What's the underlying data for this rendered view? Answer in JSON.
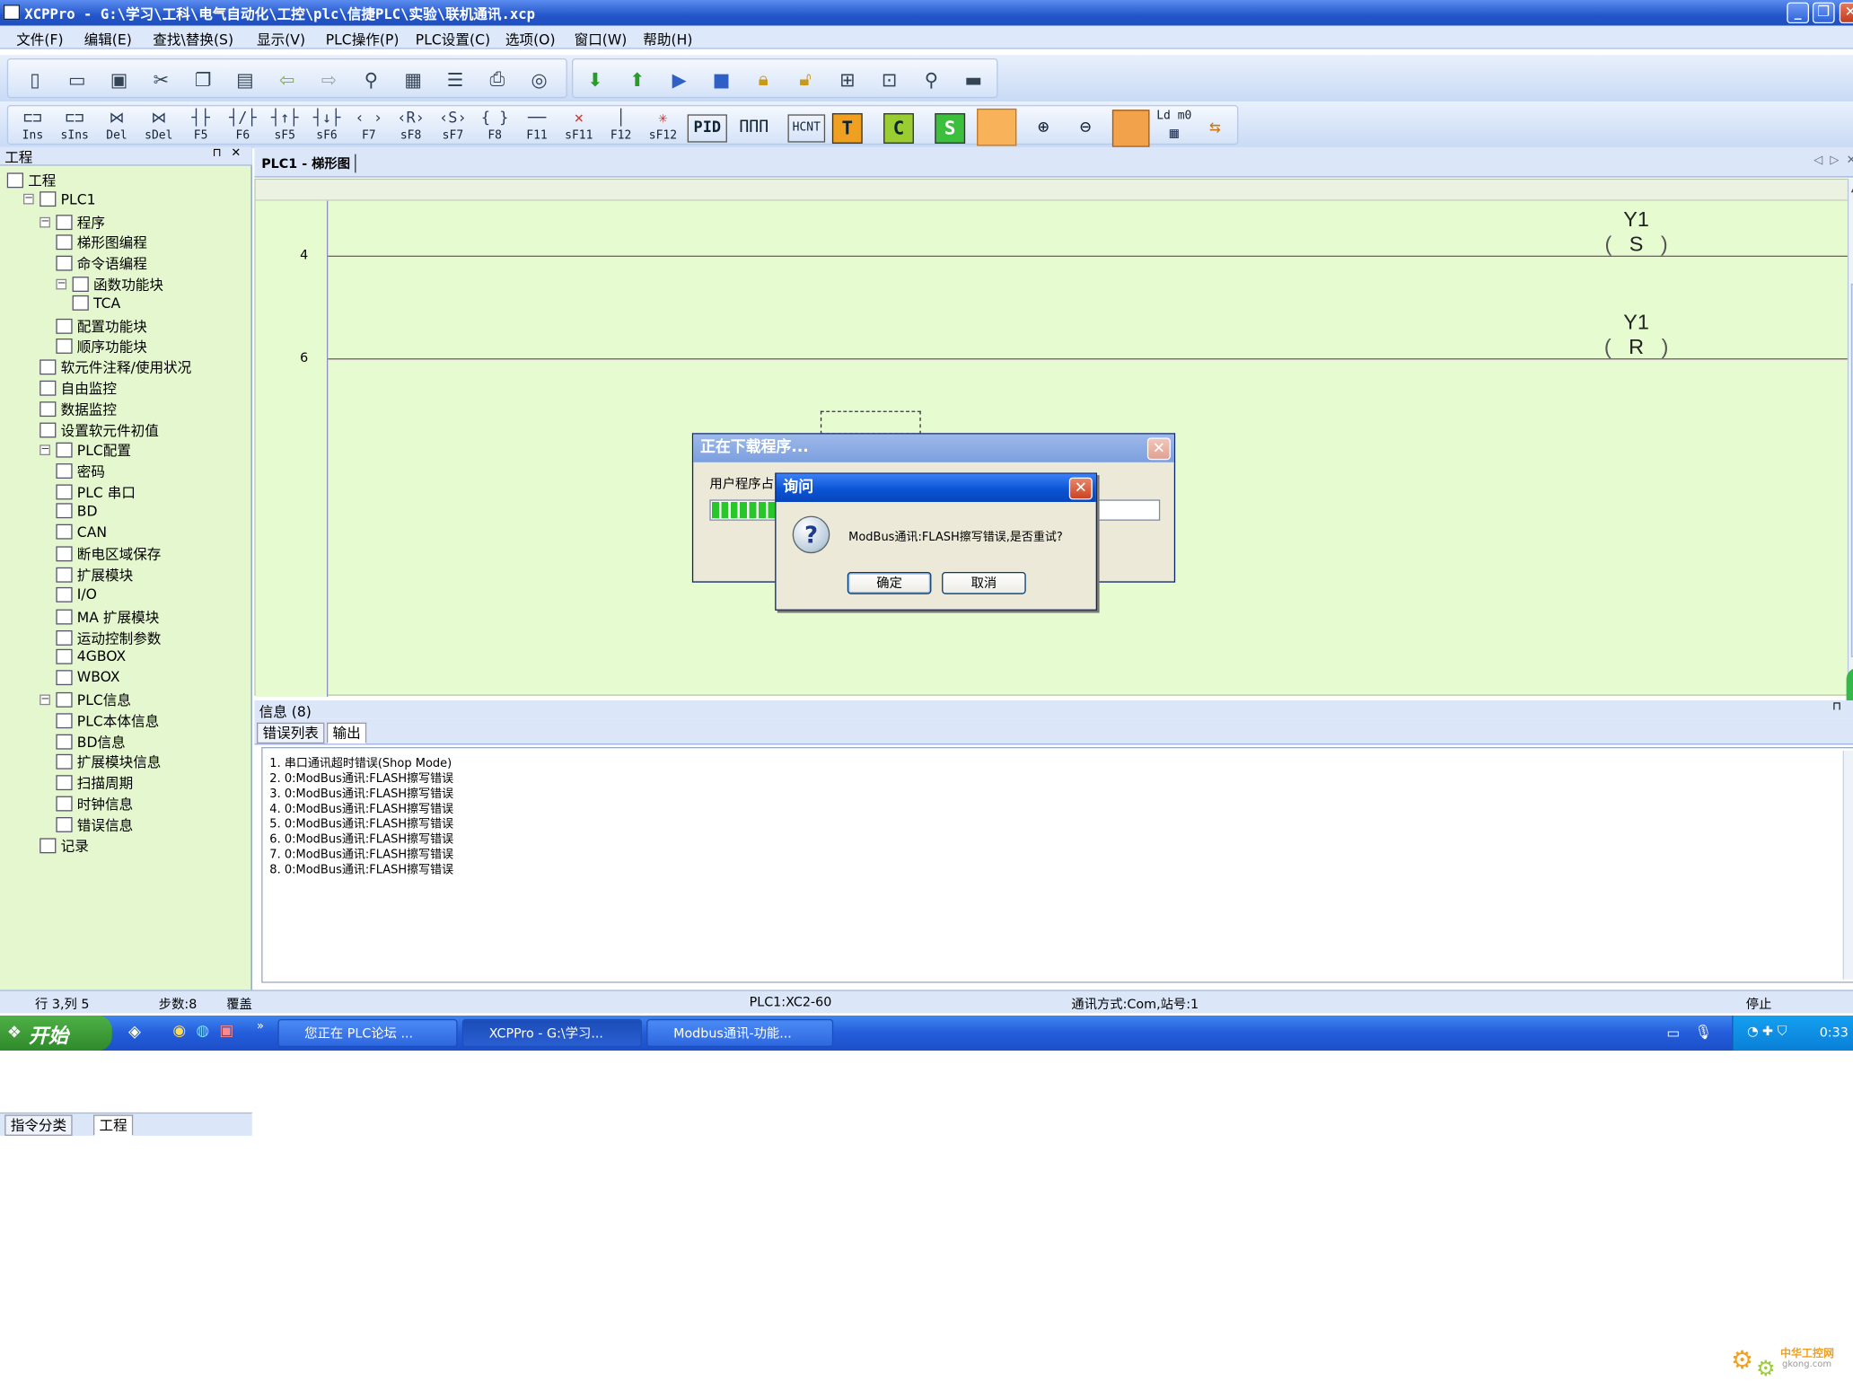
{
  "window": {
    "title": "XCPPro - G:\\学习\\工科\\电气自动化\\工控\\plc\\信捷PLC\\实验\\联机通讯.xcp",
    "minimize": "_",
    "restore": "❐",
    "close": "✕"
  },
  "menu": [
    "文件(F)",
    "编辑(E)",
    "查找\\替换(S)",
    "显示(V)",
    "PLC操作(P)",
    "PLC设置(C)",
    "选项(O)",
    "窗口(W)",
    "帮助(H)"
  ],
  "ladder_toolbar": {
    "labels": [
      "Ins",
      "sIns",
      "Del",
      "sDel",
      "F5",
      "F6",
      "sF5",
      "sF6",
      "F7",
      "sF8",
      "sF7",
      "F8",
      "F11",
      "sF11",
      "F12",
      "sF12"
    ],
    "extra": [
      "PID",
      "HCNT",
      "T",
      "C",
      "S",
      "Ld m0"
    ]
  },
  "sidebar": {
    "header": "工程",
    "pin": "⊓",
    "close": "✕",
    "tree": [
      {
        "label": "工程",
        "icon": "project-icon",
        "level": 0
      },
      {
        "label": "PLC1",
        "icon": "plc-icon",
        "level": 1
      },
      {
        "label": "程序",
        "icon": "program-icon",
        "level": 2
      },
      {
        "label": "梯形图编程",
        "icon": "ladder-icon",
        "level": 3
      },
      {
        "label": "命令语编程",
        "icon": "instruction-icon",
        "level": 3
      },
      {
        "label": "函数功能块",
        "icon": "function-block-icon",
        "level": 3
      },
      {
        "label": "TCA",
        "icon": "file-icon",
        "level": 4
      },
      {
        "label": "配置功能块",
        "icon": "config-block-icon",
        "level": 3
      },
      {
        "label": "顺序功能块",
        "icon": "sequence-block-icon",
        "level": 3
      },
      {
        "label": "软元件注释/使用状况",
        "icon": "device-comment-icon",
        "level": 2
      },
      {
        "label": "自由监控",
        "icon": "monitor-icon",
        "level": 2
      },
      {
        "label": "数据监控",
        "icon": "data-monitor-icon",
        "level": 2
      },
      {
        "label": "设置软元件初值",
        "icon": "init-value-icon",
        "level": 2
      },
      {
        "label": "PLC配置",
        "icon": "folder-icon",
        "level": 2
      },
      {
        "label": "密码",
        "icon": "password-icon",
        "level": 3
      },
      {
        "label": "PLC 串口",
        "icon": "serial-port-icon",
        "level": 3
      },
      {
        "label": "BD",
        "icon": "bd-icon",
        "level": 3
      },
      {
        "label": "CAN",
        "icon": "can-icon",
        "level": 3
      },
      {
        "label": "断电区域保存",
        "icon": "power-save-icon",
        "level": 3
      },
      {
        "label": "扩展模块",
        "icon": "expansion-module-icon",
        "level": 3
      },
      {
        "label": "I/O",
        "icon": "io-icon",
        "level": 3
      },
      {
        "label": "MA 扩展模块",
        "icon": "ma-module-icon",
        "level": 3
      },
      {
        "label": "运动控制参数",
        "icon": "motion-icon",
        "level": 3
      },
      {
        "label": "4GBOX",
        "icon": "4gbox-icon",
        "level": 3
      },
      {
        "label": "WBOX",
        "icon": "wbox-icon",
        "level": 3
      },
      {
        "label": "PLC信息",
        "icon": "folder-icon",
        "level": 2
      },
      {
        "label": "PLC本体信息",
        "icon": "plc-info-icon",
        "level": 3
      },
      {
        "label": "BD信息",
        "icon": "bd-info-icon",
        "level": 3
      },
      {
        "label": "扩展模块信息",
        "icon": "module-info-icon",
        "level": 3
      },
      {
        "label": "扫描周期",
        "icon": "scan-cycle-icon",
        "level": 3
      },
      {
        "label": "时钟信息",
        "icon": "clock-icon",
        "level": 3
      },
      {
        "label": "错误信息",
        "icon": "error-icon",
        "level": 3
      },
      {
        "label": "记录",
        "icon": "record-icon",
        "level": 2
      }
    ],
    "tabs": [
      "指令分类",
      "工程"
    ]
  },
  "document": {
    "tab": "PLC1 - 梯形图",
    "nav_prev": "◁",
    "nav_next": "▷",
    "nav_close": "✕"
  },
  "ladder": {
    "rungs": [
      {
        "number": "4",
        "coil_name": "Y1",
        "coil_op": "S"
      },
      {
        "number": "6",
        "coil_name": "Y1",
        "coil_op": "R"
      }
    ]
  },
  "info": {
    "header": "信息 (8)",
    "tabs": [
      "错误列表",
      "输出"
    ],
    "lines": [
      "1. 串口通讯超时错误(Shop Mode)",
      "2. 0:ModBus通讯:FLASH擦写错误",
      "3. 0:ModBus通讯:FLASH擦写错误",
      "4. 0:ModBus通讯:FLASH擦写错误",
      "5. 0:ModBus通讯:FLASH擦写错误",
      "6. 0:ModBus通讯:FLASH擦写错误",
      "7. 0:ModBus通讯:FLASH擦写错误",
      "8. 0:ModBus通讯:FLASH擦写错误"
    ]
  },
  "status": {
    "position": "行 3,列 5",
    "steps": "步数:8",
    "mode": "覆盖",
    "plc": "PLC1:XC2-60",
    "comm": "通讯方式:Com,站号:1",
    "state": "停止"
  },
  "download_dialog": {
    "title": "正在下载程序...",
    "label": "用户程序占",
    "progress": 0.3
  },
  "ask_dialog": {
    "title": "询问",
    "message": "ModBus通讯:FLASH擦写错误,是否重试?",
    "ok": "确定",
    "cancel": "取消"
  },
  "taskbar": {
    "start": "开始",
    "tasks": [
      "您正在 PLC论坛 ...",
      "XCPPro - G:\\学习...",
      "Modbus通讯-功能..."
    ],
    "clock": "0:33"
  },
  "watermark": {
    "line1": "中华工控网",
    "line2": "gkong.com"
  },
  "colors": {
    "ladder_bg": "#e6fbcf",
    "sidebar_bg": "#e5f7cf",
    "rung": "#8a4a8a",
    "titlebar": "#2456c9"
  }
}
